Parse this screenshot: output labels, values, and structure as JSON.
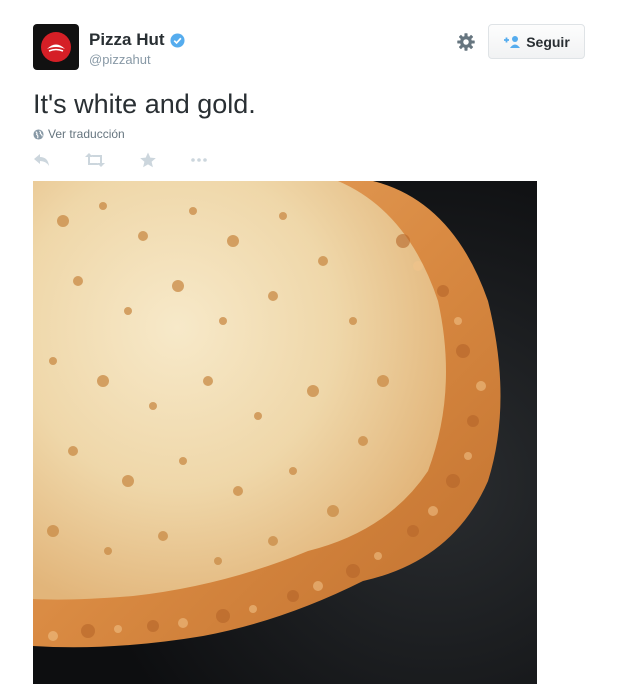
{
  "tweet": {
    "author_name": "Pizza Hut",
    "author_handle": "@pizzahut",
    "text": "It's white and gold.",
    "translate_label": "Ver traducción",
    "follow_label": "Seguir"
  },
  "icons": {
    "avatar": "pizza-hut-logo",
    "verified": "verified-badge-icon",
    "settings": "gear-icon",
    "follow": "add-user-icon",
    "translate": "globe-icon",
    "reply": "reply-icon",
    "retweet": "retweet-icon",
    "favorite": "star-icon",
    "more": "more-icon"
  },
  "colors": {
    "brand_red": "#d51f26",
    "verified_blue": "#55acee",
    "icon_gray": "#ccd6dd",
    "text_gray": "#8899a6"
  }
}
